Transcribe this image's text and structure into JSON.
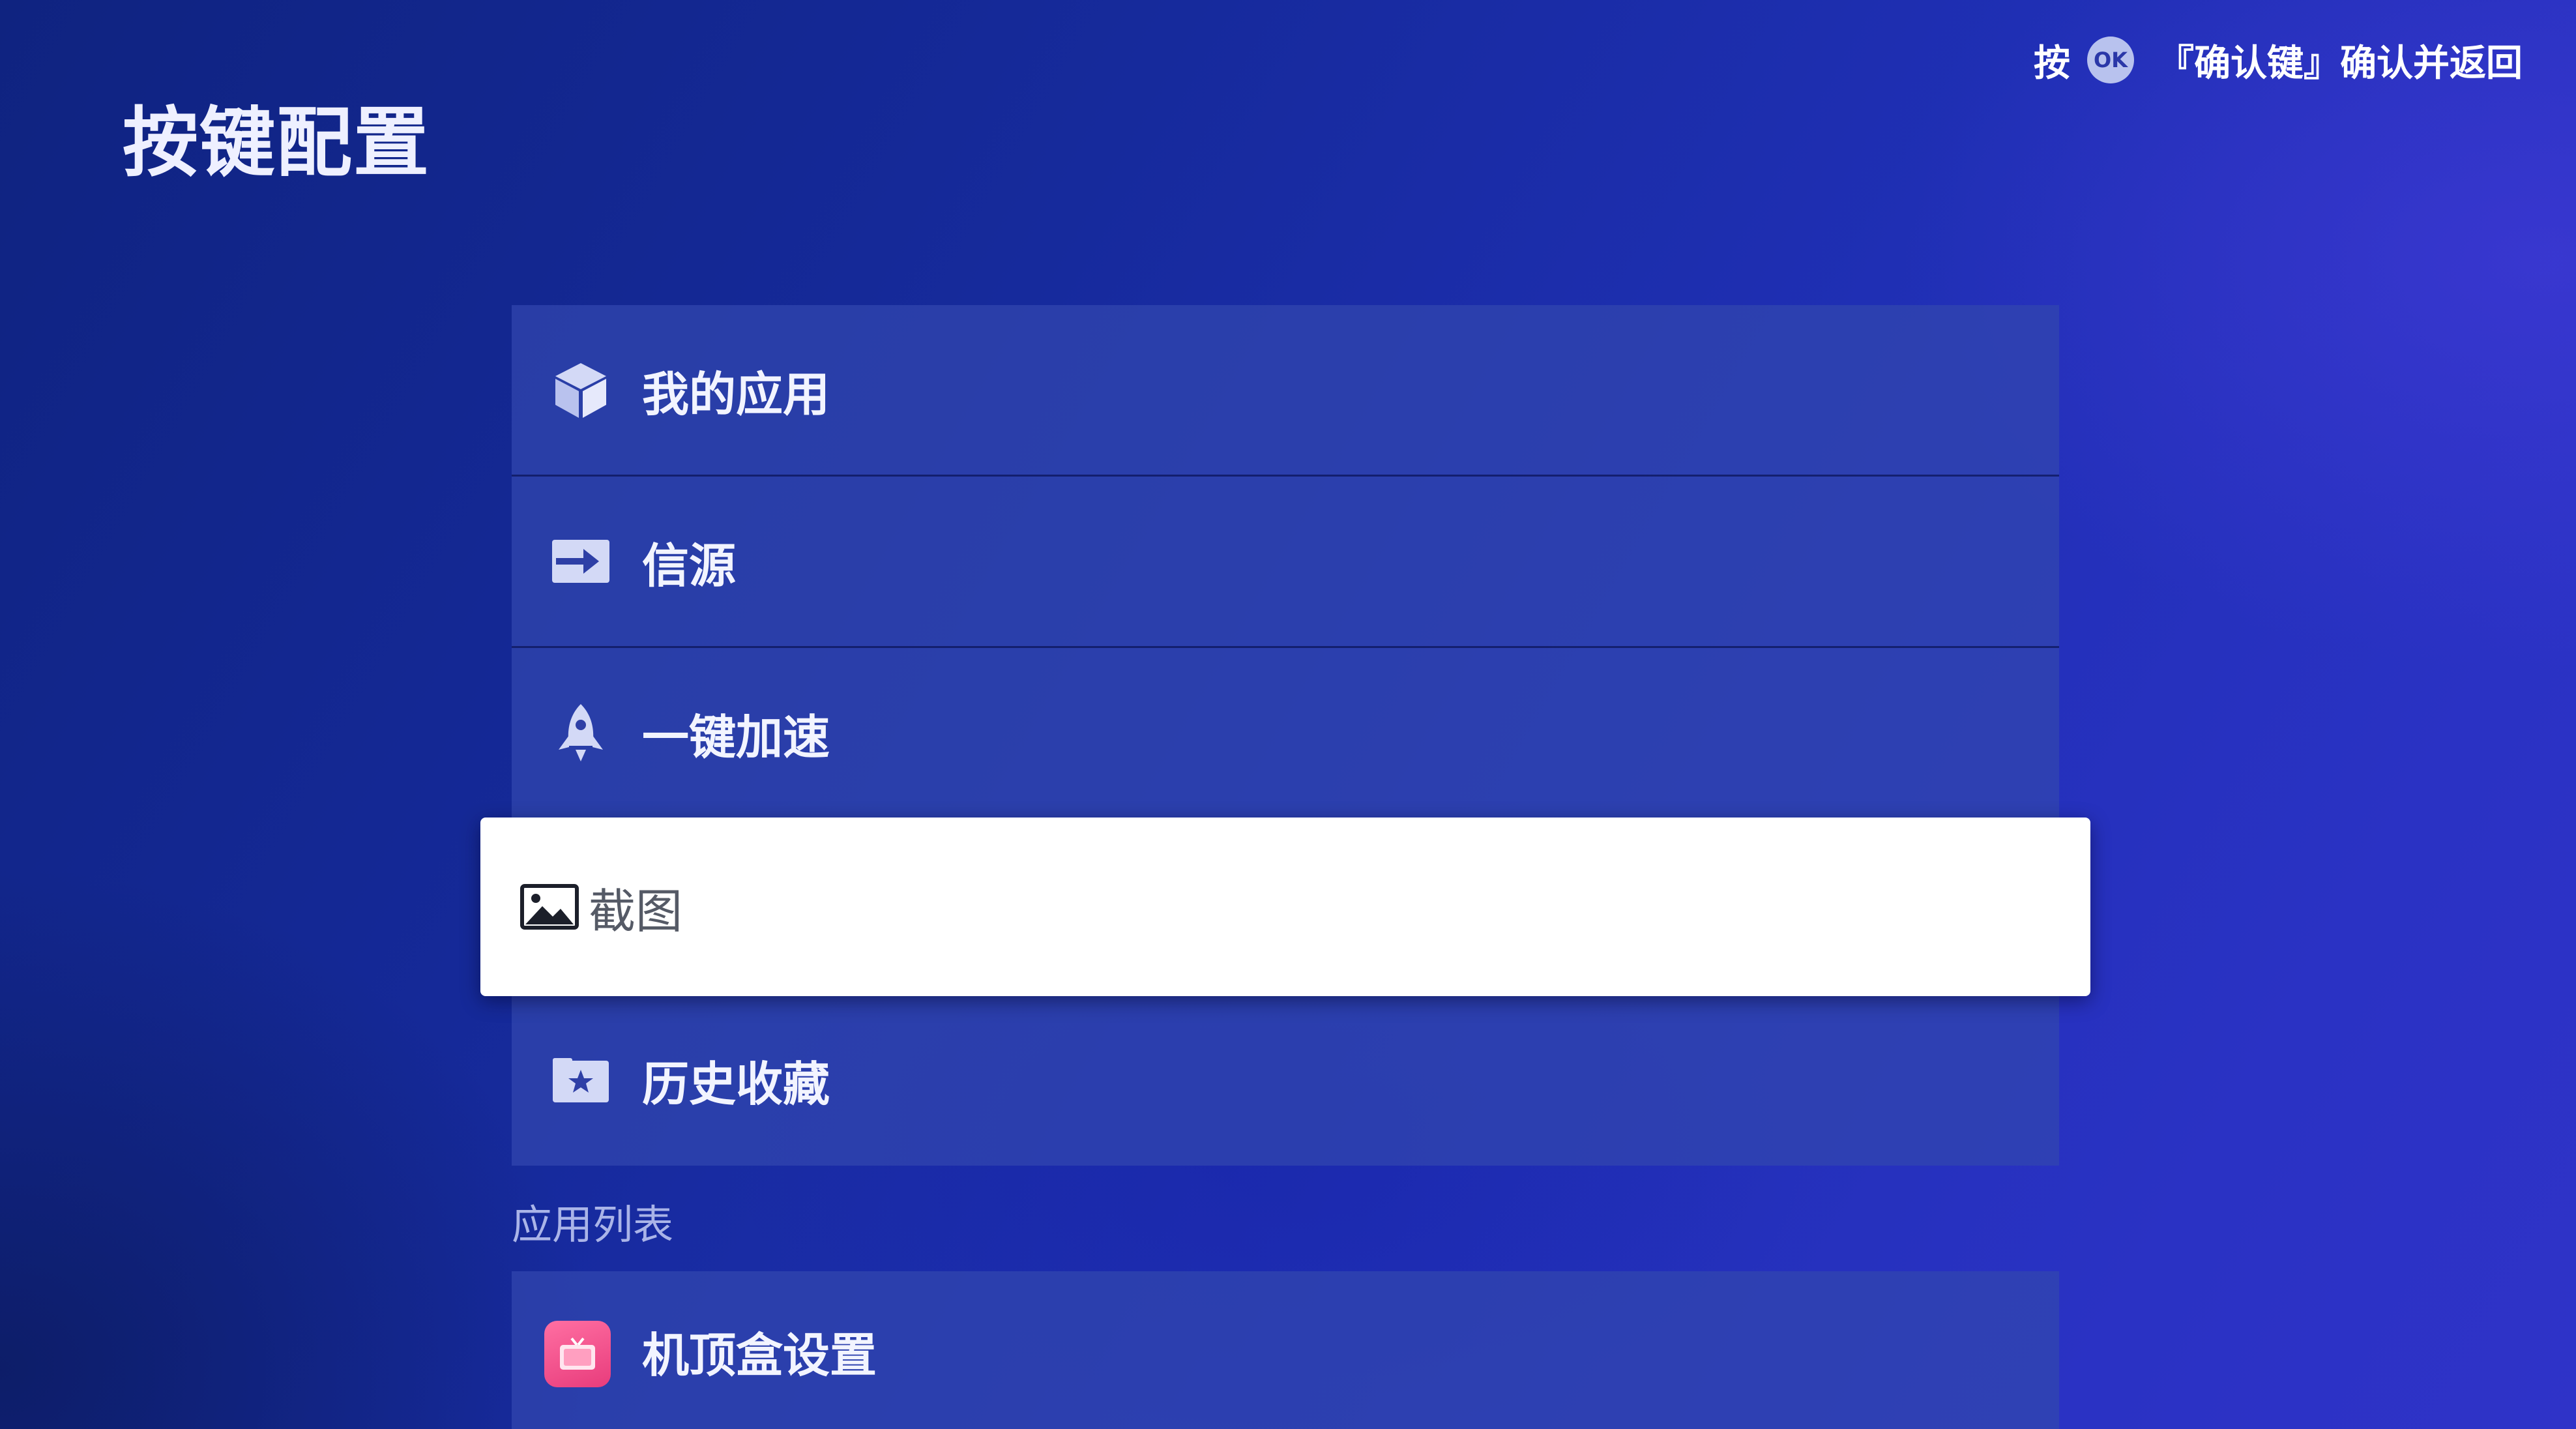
{
  "header": {
    "title": "按键配置",
    "hint_prefix": "按",
    "hint_badge": "OK",
    "hint_suffix": "『确认键』确认并返回"
  },
  "menu": {
    "items": [
      {
        "label": "我的应用",
        "icon": "cube-icon",
        "selected": false
      },
      {
        "label": "信源",
        "icon": "input-source-icon",
        "selected": false
      },
      {
        "label": "一键加速",
        "icon": "rocket-icon",
        "selected": false
      },
      {
        "label": "截图",
        "icon": "image-icon",
        "selected": true
      },
      {
        "label": "历史收藏",
        "icon": "star-folder-icon",
        "selected": false
      }
    ]
  },
  "apps_section": {
    "title": "应用列表",
    "items": [
      {
        "label": "机顶盒设置",
        "icon": "tv-box-app-icon"
      }
    ]
  },
  "colors": {
    "background": "#1a2ba6",
    "row": "#3246af",
    "selected_row": "#ffffff",
    "app_icon": "#e83c7c"
  }
}
